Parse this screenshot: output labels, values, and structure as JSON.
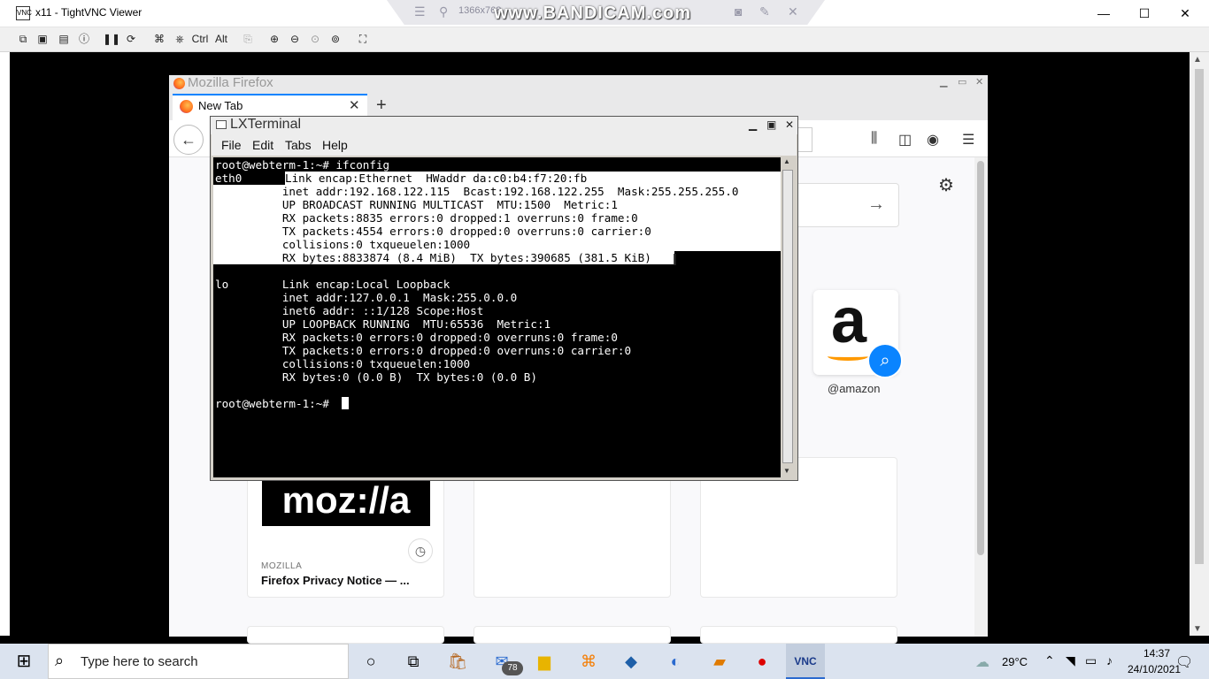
{
  "vnc": {
    "title": "x11 - TightVNC Viewer",
    "logo": "VNC",
    "controls": {
      "minimize": "—",
      "maximize": "☐",
      "close": "✕"
    },
    "toolbar": {
      "ctrl_label": "Ctrl",
      "alt_label": "Alt"
    }
  },
  "bandicam": {
    "resolution": "1366x768",
    "watermark": "www.BANDICAM.com"
  },
  "firefox": {
    "window_title": "Mozilla Firefox",
    "tab_title": "New Tab",
    "top_sites": [
      {
        "label": "@amazon"
      }
    ],
    "highlight_card": {
      "source": "MOZILLA",
      "title": "Firefox Privacy Notice — ...",
      "image_text": "moz://a"
    }
  },
  "terminal": {
    "title": "LXTerminal",
    "menu": [
      "File",
      "Edit",
      "Tabs",
      "Help"
    ],
    "lines": [
      "root@webterm-1:~# ifconfig",
      "eth0      Link encap:Ethernet  HWaddr da:c0:b4:f7:20:fb",
      "          inet addr:192.168.122.115  Bcast:192.168.122.255  Mask:255.255.255.0",
      "          UP BROADCAST RUNNING MULTICAST  MTU:1500  Metric:1",
      "          RX packets:8835 errors:0 dropped:1 overruns:0 frame:0",
      "          TX packets:4554 errors:0 dropped:0 overruns:0 carrier:0",
      "          collisions:0 txqueuelen:1000",
      "          RX bytes:8833874 (8.4 MiB)  TX bytes:390685 (381.5 KiB)",
      "",
      "lo        Link encap:Local Loopback",
      "          inet addr:127.0.0.1  Mask:255.0.0.0",
      "          inet6 addr: ::1/128 Scope:Host",
      "          UP LOOPBACK RUNNING  MTU:65536  Metric:1",
      "          RX packets:0 errors:0 dropped:0 overruns:0 frame:0",
      "          TX packets:0 errors:0 dropped:0 overruns:0 carrier:0",
      "          collisions:0 txqueuelen:1000",
      "          RX bytes:0 (0.0 B)  TX bytes:0 (0.0 B)",
      "",
      "root@webterm-1:~# "
    ]
  },
  "taskbar": {
    "search_placeholder": "Type here to search",
    "mail_badge": "78",
    "weather_temp": "29°C",
    "time": "14:37",
    "date": "24/10/2021"
  }
}
